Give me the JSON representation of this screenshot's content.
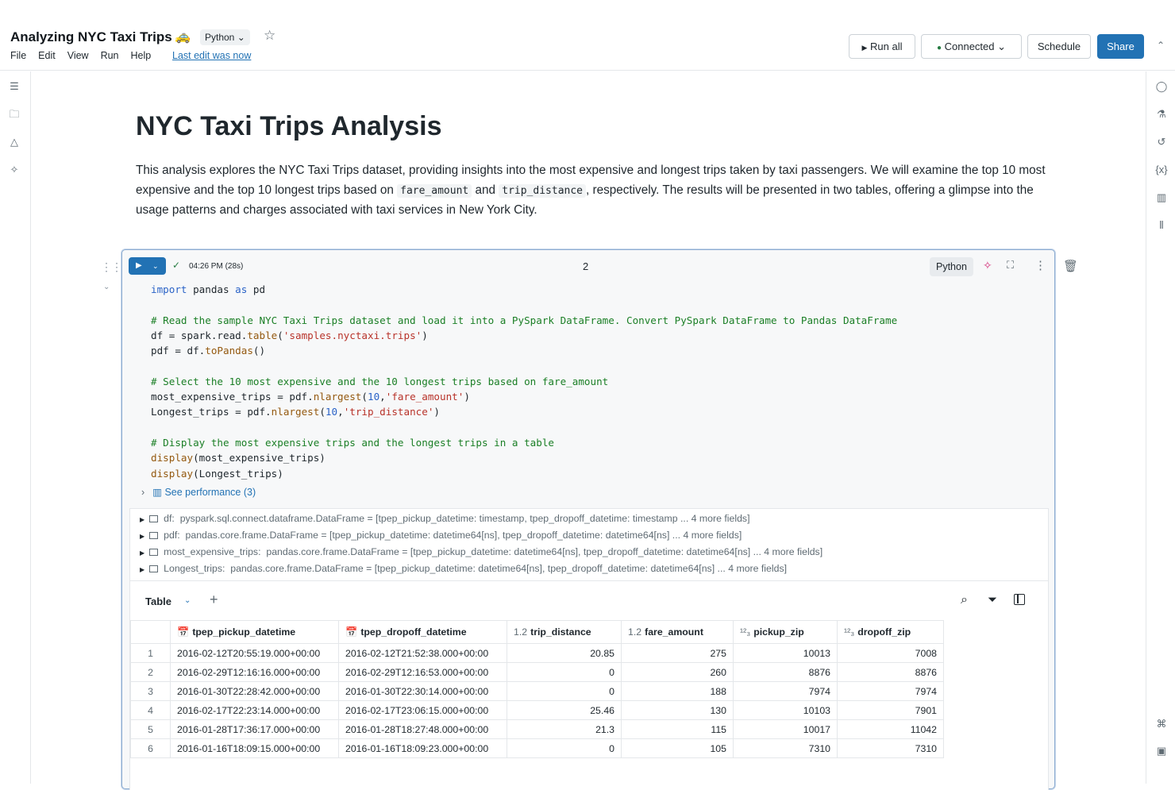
{
  "header": {
    "title": "Analyzing NYC Taxi Trips",
    "emoji": "🚕",
    "language": "Python",
    "menu": [
      "File",
      "Edit",
      "View",
      "Run",
      "Help"
    ],
    "last_edit": "Last edit was now",
    "run_all": "Run all",
    "connected": "Connected",
    "schedule": "Schedule",
    "share": "Share"
  },
  "doc": {
    "title": "NYC Taxi Trips Analysis",
    "desc_part1": "This analysis explores the NYC Taxi Trips dataset, providing insights into the most expensive and longest trips taken by taxi passengers. We will examine the top 10 most expensive and the top 10 longest trips based on ",
    "chip1": "fare_amount",
    "desc_and": " and ",
    "chip2": "trip_distance",
    "desc_part2": ", respectively. The results will be presented in two tables, offering a glimpse into the usage patterns and charges associated with taxi services in New York City."
  },
  "cell": {
    "runtime": "04:26 PM (28s)",
    "number": "2",
    "language": "Python",
    "performance": "See performance (3)"
  },
  "variables": [
    {
      "name": "df:",
      "type": "pyspark.sql.connect.dataframe.DataFrame = [tpep_pickup_datetime: timestamp, tpep_dropoff_datetime: timestamp ... 4 more fields]"
    },
    {
      "name": "pdf:",
      "type": "pandas.core.frame.DataFrame = [tpep_pickup_datetime: datetime64[ns], tpep_dropoff_datetime: datetime64[ns] ... 4 more fields]"
    },
    {
      "name": "most_expensive_trips:",
      "type": "pandas.core.frame.DataFrame = [tpep_pickup_datetime: datetime64[ns], tpep_dropoff_datetime: datetime64[ns] ... 4 more fields]"
    },
    {
      "name": "Longest_trips:",
      "type": "pandas.core.frame.DataFrame = [tpep_pickup_datetime: datetime64[ns], tpep_dropoff_datetime: datetime64[ns] ... 4 more fields]"
    }
  ],
  "result": {
    "tab": "Table",
    "columns": [
      {
        "type": "📅",
        "name": "tpep_pickup_datetime"
      },
      {
        "type": "📅",
        "name": "tpep_dropoff_datetime"
      },
      {
        "type": "1.2",
        "name": "trip_distance"
      },
      {
        "type": "1.2",
        "name": "fare_amount"
      },
      {
        "type": "¹²₃",
        "name": "pickup_zip"
      },
      {
        "type": "¹²₃",
        "name": "dropoff_zip"
      }
    ],
    "rows": [
      [
        "1",
        "2016-02-12T20:55:19.000+00:00",
        "2016-02-12T21:52:38.000+00:00",
        "20.85",
        "275",
        "10013",
        "7008"
      ],
      [
        "2",
        "2016-02-29T12:16:16.000+00:00",
        "2016-02-29T12:16:53.000+00:00",
        "0",
        "260",
        "8876",
        "8876"
      ],
      [
        "3",
        "2016-01-30T22:28:42.000+00:00",
        "2016-01-30T22:30:14.000+00:00",
        "0",
        "188",
        "7974",
        "7974"
      ],
      [
        "4",
        "2016-02-17T22:23:14.000+00:00",
        "2016-02-17T23:06:15.000+00:00",
        "25.46",
        "130",
        "10103",
        "7901"
      ],
      [
        "5",
        "2016-01-28T17:36:17.000+00:00",
        "2016-01-28T18:27:48.000+00:00",
        "21.3",
        "115",
        "10017",
        "11042"
      ],
      [
        "6",
        "2016-01-16T18:09:15.000+00:00",
        "2016-01-16T18:09:23.000+00:00",
        "0",
        "105",
        "7310",
        "7310"
      ]
    ]
  }
}
